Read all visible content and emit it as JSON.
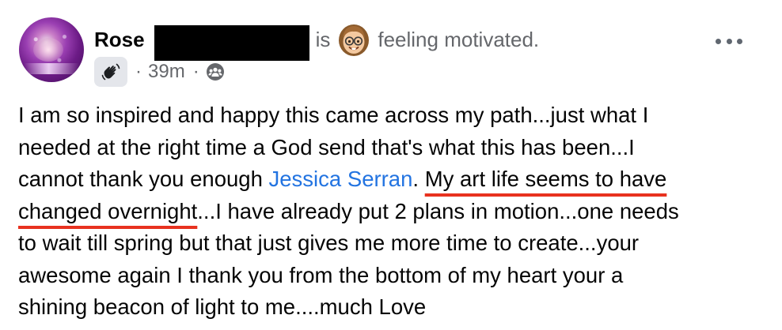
{
  "post": {
    "author_first_name": "Rose",
    "is_text": "is",
    "feeling_emoji": "nerd-face-emoji",
    "feeling_text": "feeling motivated.",
    "more_icon": "more-horizontal-icon",
    "badge_icon": "waving-hand-icon",
    "meta_dot_1": "·",
    "timestamp": "39m",
    "meta_dot_2": "·",
    "audience_icon": "group-audience-icon",
    "lines": {
      "l1": "I am so inspired and happy this came across my path...just what I",
      "l2": "needed at the right time a God send that's what this has been...I",
      "l3_before_mention": "cannot thank you enough ",
      "l3_mention": "Jessica Serran",
      "l3_after_mention": ". ",
      "l3_highlight": "My art life seems to have",
      "l4_highlight": "changed overnight",
      "l4_rest": "...I have already put 2 plans in motion...one needs",
      "l5": "to wait till spring but that just gives me more time to create...your",
      "l6": "awesome again I thank you from the bottom of my heart your a",
      "l7": "shining beacon of light to me....much Love"
    }
  },
  "colors": {
    "text_primary": "#050505",
    "text_secondary": "#65676b",
    "mention_blue": "#2374e1",
    "highlight_underline_red": "#e8321f",
    "badge_background": "#e4e6eb"
  }
}
